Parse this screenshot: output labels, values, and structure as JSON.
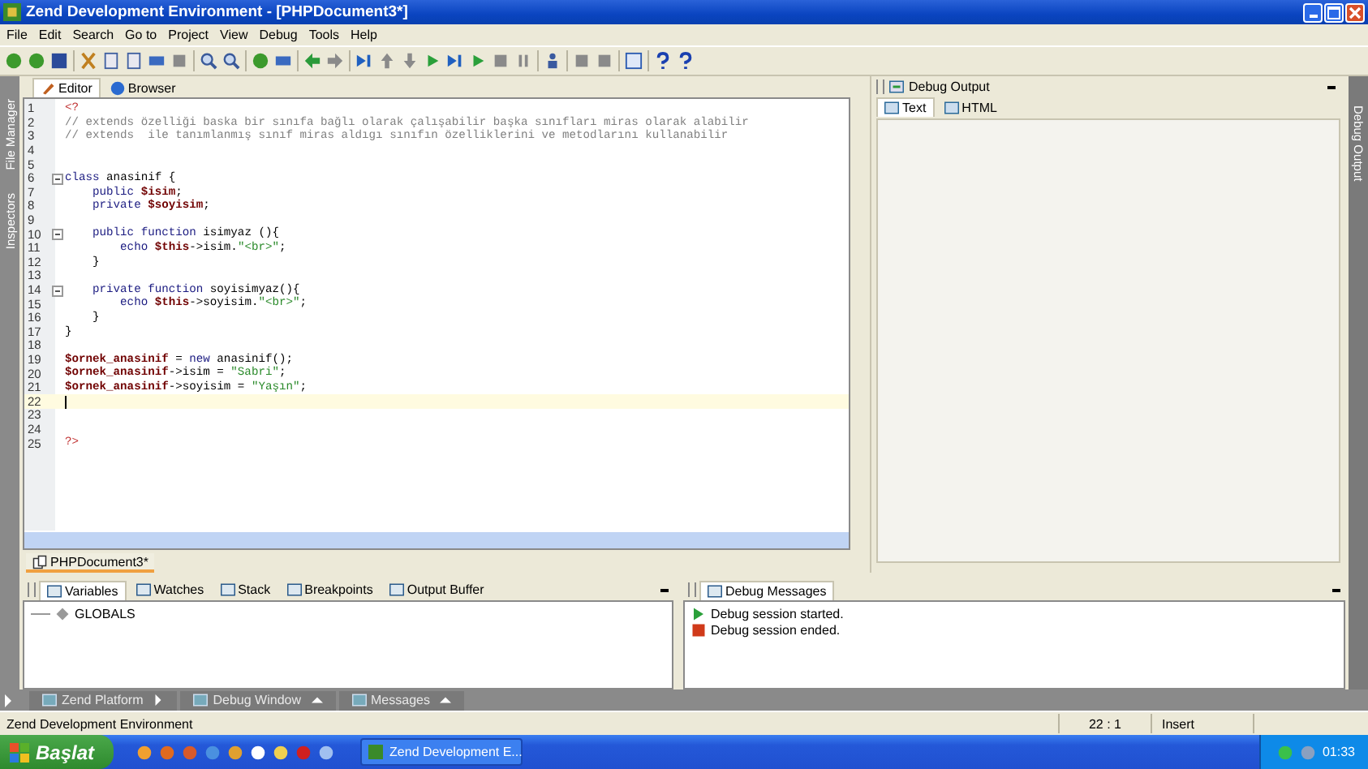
{
  "window": {
    "title": "Zend Development Environment - [PHPDocument3*]"
  },
  "menu": [
    "File",
    "Edit",
    "Search",
    "Go to",
    "Project",
    "View",
    "Debug",
    "Tools",
    "Help"
  ],
  "side_panels_left": [
    "File Manager",
    "Inspectors"
  ],
  "side_panel_right": "Debug Output",
  "editor_tabs": [
    {
      "label": "Editor",
      "selected": true
    },
    {
      "label": "Browser",
      "selected": false
    }
  ],
  "editor": {
    "lines": [
      {
        "n": "1",
        "fold": false,
        "current": false,
        "tokens": [
          {
            "kind": "tag",
            "t": "<?"
          }
        ]
      },
      {
        "n": "2",
        "fold": false,
        "current": false,
        "tokens": [
          {
            "kind": "comment",
            "t": "// extends özelliği baska bir sınıfa bağlı olarak çalışabilir başka sınıfları miras olarak alabilir"
          }
        ]
      },
      {
        "n": "3",
        "fold": false,
        "current": false,
        "tokens": [
          {
            "kind": "comment",
            "t": "// extends  ile tanımlanmış sınıf miras aldıgı sınıfın özelliklerini ve metodlarını kullanabilir"
          }
        ]
      },
      {
        "n": "4",
        "fold": false,
        "current": false
      },
      {
        "n": "5",
        "fold": false,
        "current": false
      },
      {
        "n": "6",
        "fold": true,
        "current": false,
        "tokens": [
          {
            "kind": "keyword",
            "t": "class"
          },
          {
            "kind": "plain",
            "t": " anasinif {"
          }
        ]
      },
      {
        "n": "7",
        "fold": false,
        "current": false,
        "tokens": [
          {
            "kind": "keyword",
            "t": "    public"
          },
          {
            "kind": "var",
            "t": " $isim"
          },
          {
            "kind": "plain",
            "t": ";"
          }
        ]
      },
      {
        "n": "8",
        "fold": false,
        "current": false,
        "tokens": [
          {
            "kind": "keyword",
            "t": "    private"
          },
          {
            "kind": "var",
            "t": " $soyisim"
          },
          {
            "kind": "plain",
            "t": ";"
          }
        ]
      },
      {
        "n": "9",
        "fold": false,
        "current": false
      },
      {
        "n": "10",
        "fold": true,
        "current": false,
        "tokens": [
          {
            "kind": "keyword",
            "t": "    public function"
          },
          {
            "kind": "plain",
            "t": " isimyaz (){"
          }
        ]
      },
      {
        "n": "11",
        "fold": false,
        "current": false,
        "tokens": [
          {
            "kind": "keyword",
            "t": "        echo"
          },
          {
            "kind": "var",
            "t": " $this"
          },
          {
            "kind": "plain",
            "t": "->isim."
          },
          {
            "kind": "string",
            "t": "\"<br>\""
          },
          {
            "kind": "plain",
            "t": ";"
          }
        ]
      },
      {
        "n": "12",
        "fold": false,
        "current": false,
        "tokens": [
          {
            "kind": "plain",
            "t": "    }"
          }
        ]
      },
      {
        "n": "13",
        "fold": false,
        "current": false
      },
      {
        "n": "14",
        "fold": true,
        "current": false,
        "tokens": [
          {
            "kind": "keyword",
            "t": "    private function"
          },
          {
            "kind": "plain",
            "t": " soyisimyaz(){"
          }
        ]
      },
      {
        "n": "15",
        "fold": false,
        "current": false,
        "tokens": [
          {
            "kind": "keyword",
            "t": "        echo"
          },
          {
            "kind": "var",
            "t": " $this"
          },
          {
            "kind": "plain",
            "t": "->soyisim."
          },
          {
            "kind": "string",
            "t": "\"<br>\""
          },
          {
            "kind": "plain",
            "t": ";"
          }
        ]
      },
      {
        "n": "16",
        "fold": false,
        "current": false,
        "tokens": [
          {
            "kind": "plain",
            "t": "    }"
          }
        ]
      },
      {
        "n": "17",
        "fold": false,
        "current": false,
        "tokens": [
          {
            "kind": "plain",
            "t": "}"
          }
        ]
      },
      {
        "n": "18",
        "fold": false,
        "current": false
      },
      {
        "n": "19",
        "fold": false,
        "current": false,
        "tokens": [
          {
            "kind": "var",
            "t": "$ornek_anasinif"
          },
          {
            "kind": "plain",
            "t": " = "
          },
          {
            "kind": "keyword",
            "t": "new"
          },
          {
            "kind": "plain",
            "t": " anasinif();"
          }
        ]
      },
      {
        "n": "20",
        "fold": false,
        "current": false,
        "tokens": [
          {
            "kind": "var",
            "t": "$ornek_anasinif"
          },
          {
            "kind": "plain",
            "t": "->isim = "
          },
          {
            "kind": "string",
            "t": "\"Sabri\""
          },
          {
            "kind": "plain",
            "t": ";"
          }
        ]
      },
      {
        "n": "21",
        "fold": false,
        "current": false,
        "tokens": [
          {
            "kind": "var",
            "t": "$ornek_anasinif"
          },
          {
            "kind": "plain",
            "t": "->soyisim = "
          },
          {
            "kind": "string",
            "t": "\"Yaşın\""
          },
          {
            "kind": "plain",
            "t": ";"
          }
        ]
      },
      {
        "n": "22",
        "fold": false,
        "current": true
      },
      {
        "n": "23",
        "fold": false,
        "current": false
      },
      {
        "n": "24",
        "fold": false,
        "current": false
      },
      {
        "n": "25",
        "fold": false,
        "current": false,
        "tokens": [
          {
            "kind": "tag",
            "t": "?>"
          }
        ]
      }
    ]
  },
  "document_tabs": [
    {
      "label": "PHPDocument3*",
      "selected": true
    }
  ],
  "debug_output": {
    "title": "Debug Output",
    "tabs": [
      {
        "label": "Text",
        "selected": true
      },
      {
        "label": "HTML",
        "selected": false
      }
    ]
  },
  "debug_tabs": [
    {
      "label": "Variables",
      "selected": true
    },
    {
      "label": "Watches",
      "selected": false
    },
    {
      "label": "Stack",
      "selected": false
    },
    {
      "label": "Breakpoints",
      "selected": false
    },
    {
      "label": "Output Buffer",
      "selected": false
    }
  ],
  "variables": [
    {
      "name": "GLOBALS"
    }
  ],
  "messages": {
    "title": "Debug Messages",
    "items": [
      {
        "kind": "started",
        "text": "Debug session started."
      },
      {
        "kind": "ended",
        "text": "Debug session ended."
      }
    ]
  },
  "dock_bar": [
    {
      "label": "Zend Platform",
      "kind": "right"
    },
    {
      "label": "Debug Window",
      "kind": "up"
    },
    {
      "label": "Messages",
      "kind": "up"
    }
  ],
  "status_bar": {
    "text": "Zend Development Environment",
    "position": "22 : 1",
    "mode": "Insert"
  },
  "taskbar": {
    "start": "Başlat",
    "task": "Zend Development E...",
    "clock": "01:33"
  }
}
